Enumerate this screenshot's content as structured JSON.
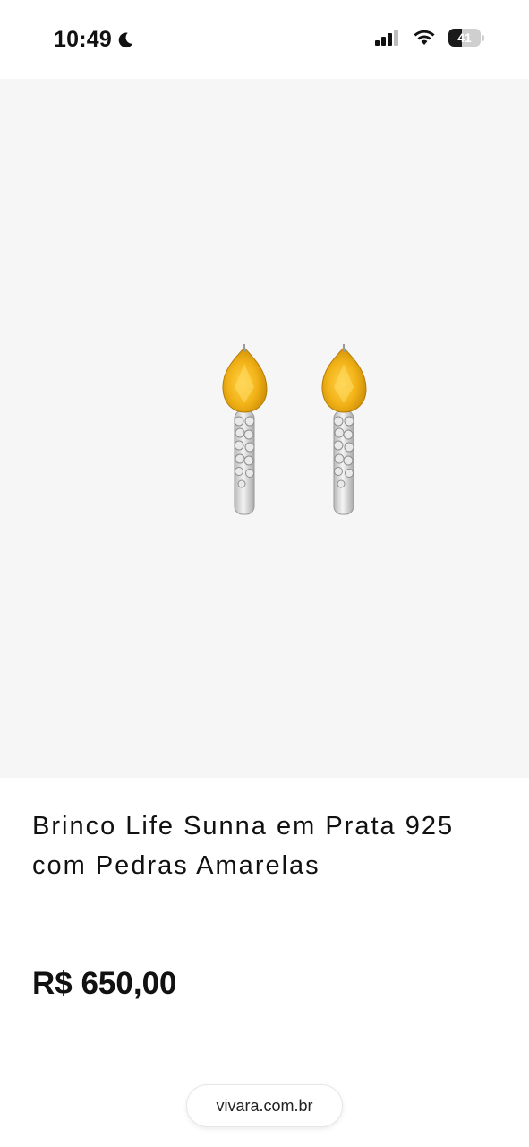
{
  "status_bar": {
    "time": "10:49",
    "battery_level": "41"
  },
  "product": {
    "title_line1": "Brinco Life Sunna em Prata 925",
    "title_line2": "com Pedras Amarelas",
    "price": "R$ 650,00"
  },
  "browser": {
    "url": "vivara.com.br"
  },
  "colors": {
    "image_background": "#f6f6f6",
    "gem_yellow": "#f2b318",
    "silver": "#d8d8d8"
  }
}
